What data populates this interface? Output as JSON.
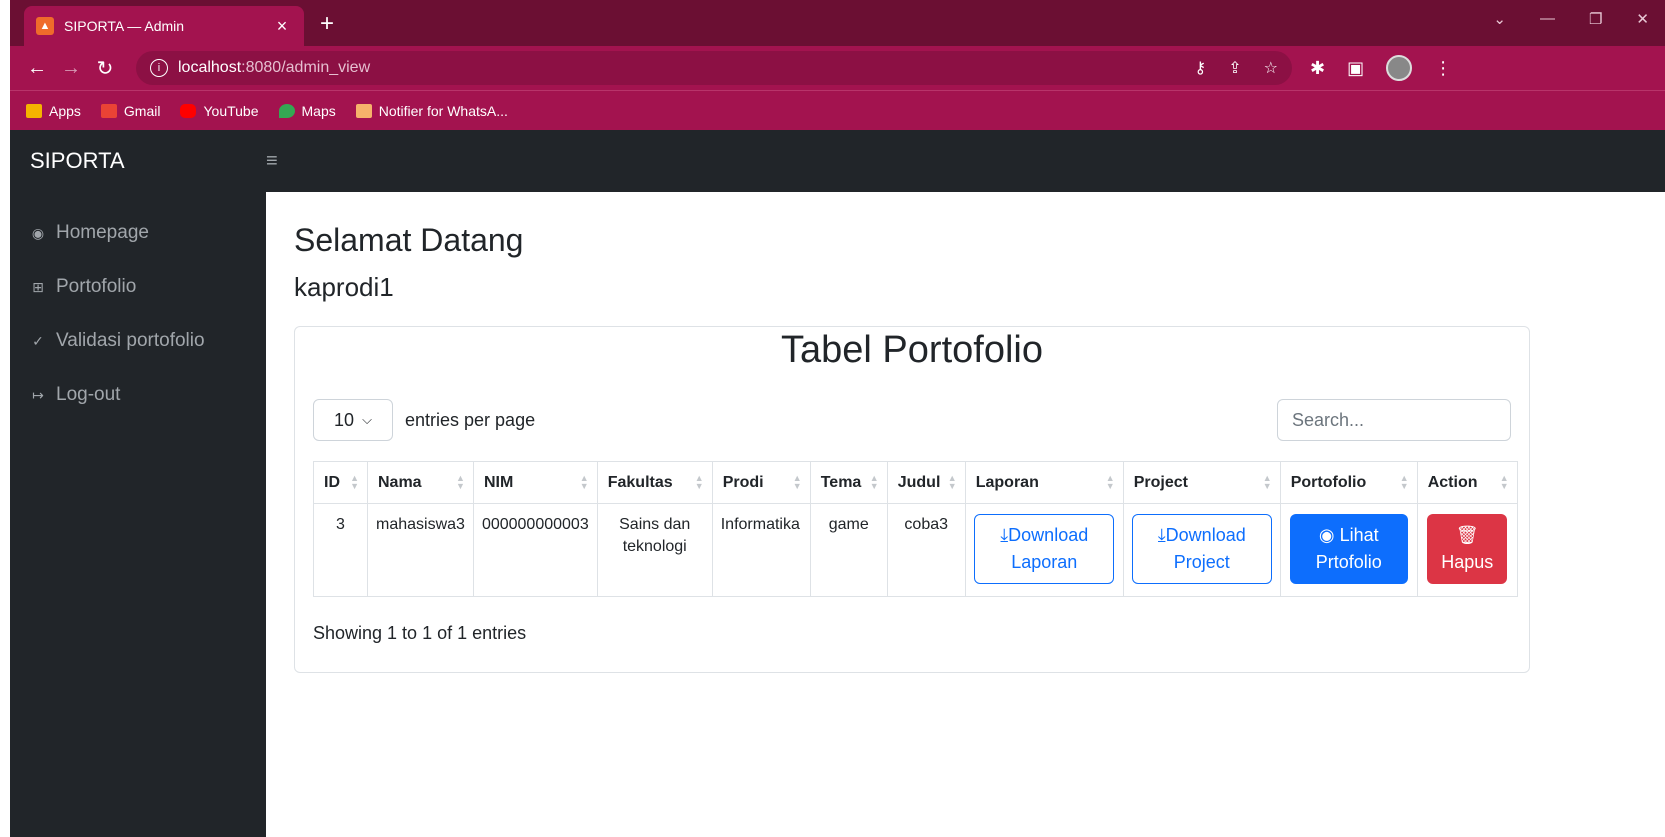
{
  "browser": {
    "tab_title": "SIPORTA — Admin",
    "tab_close": "×",
    "new_tab": "+",
    "url_host": "localhost",
    "url_path": ":8080/admin_view",
    "bookmarks": [
      {
        "label": "Apps",
        "color": "#f4b400"
      },
      {
        "label": "Gmail",
        "color": "#ea4335"
      },
      {
        "label": "YouTube",
        "color": "#ff0000"
      },
      {
        "label": "Maps",
        "color": "#34a853"
      },
      {
        "label": "Notifier for WhatsA...",
        "color": "#f6b26b"
      }
    ]
  },
  "app": {
    "brand": "SIPORTA",
    "sidebar": [
      {
        "label": "Homepage",
        "icon": "◉"
      },
      {
        "label": "Portofolio",
        "icon": "⊞"
      },
      {
        "label": "Validasi portofolio",
        "icon": "✓"
      },
      {
        "label": "Log-out",
        "icon": "↦"
      }
    ],
    "welcome": "Selamat Datang",
    "username": "kaprodi1",
    "card_title": "Tabel Portofolio",
    "entries_value": "10",
    "entries_label": "entries per page",
    "search_placeholder": "Search...",
    "columns": [
      "ID",
      "Nama",
      "NIM",
      "Fakultas",
      "Prodi",
      "Tema",
      "Judul",
      "Laporan",
      "Project",
      "Portofolio",
      "Action"
    ],
    "rows": [
      {
        "id": "3",
        "nama": "mahasiswa3",
        "nim": "000000000003",
        "fakultas_1": "Sains dan",
        "fakultas_2": "teknologi",
        "prodi": "Informatika",
        "tema": "game",
        "judul": "coba3",
        "laporan_1": "Download",
        "laporan_2": "Laporan",
        "project_1": "Download",
        "project_2": "Project",
        "porto_1": "Lihat",
        "porto_2": "Prtofolio",
        "action": "Hapus"
      }
    ],
    "showing": "Showing 1 to 1 of 1 entries"
  }
}
